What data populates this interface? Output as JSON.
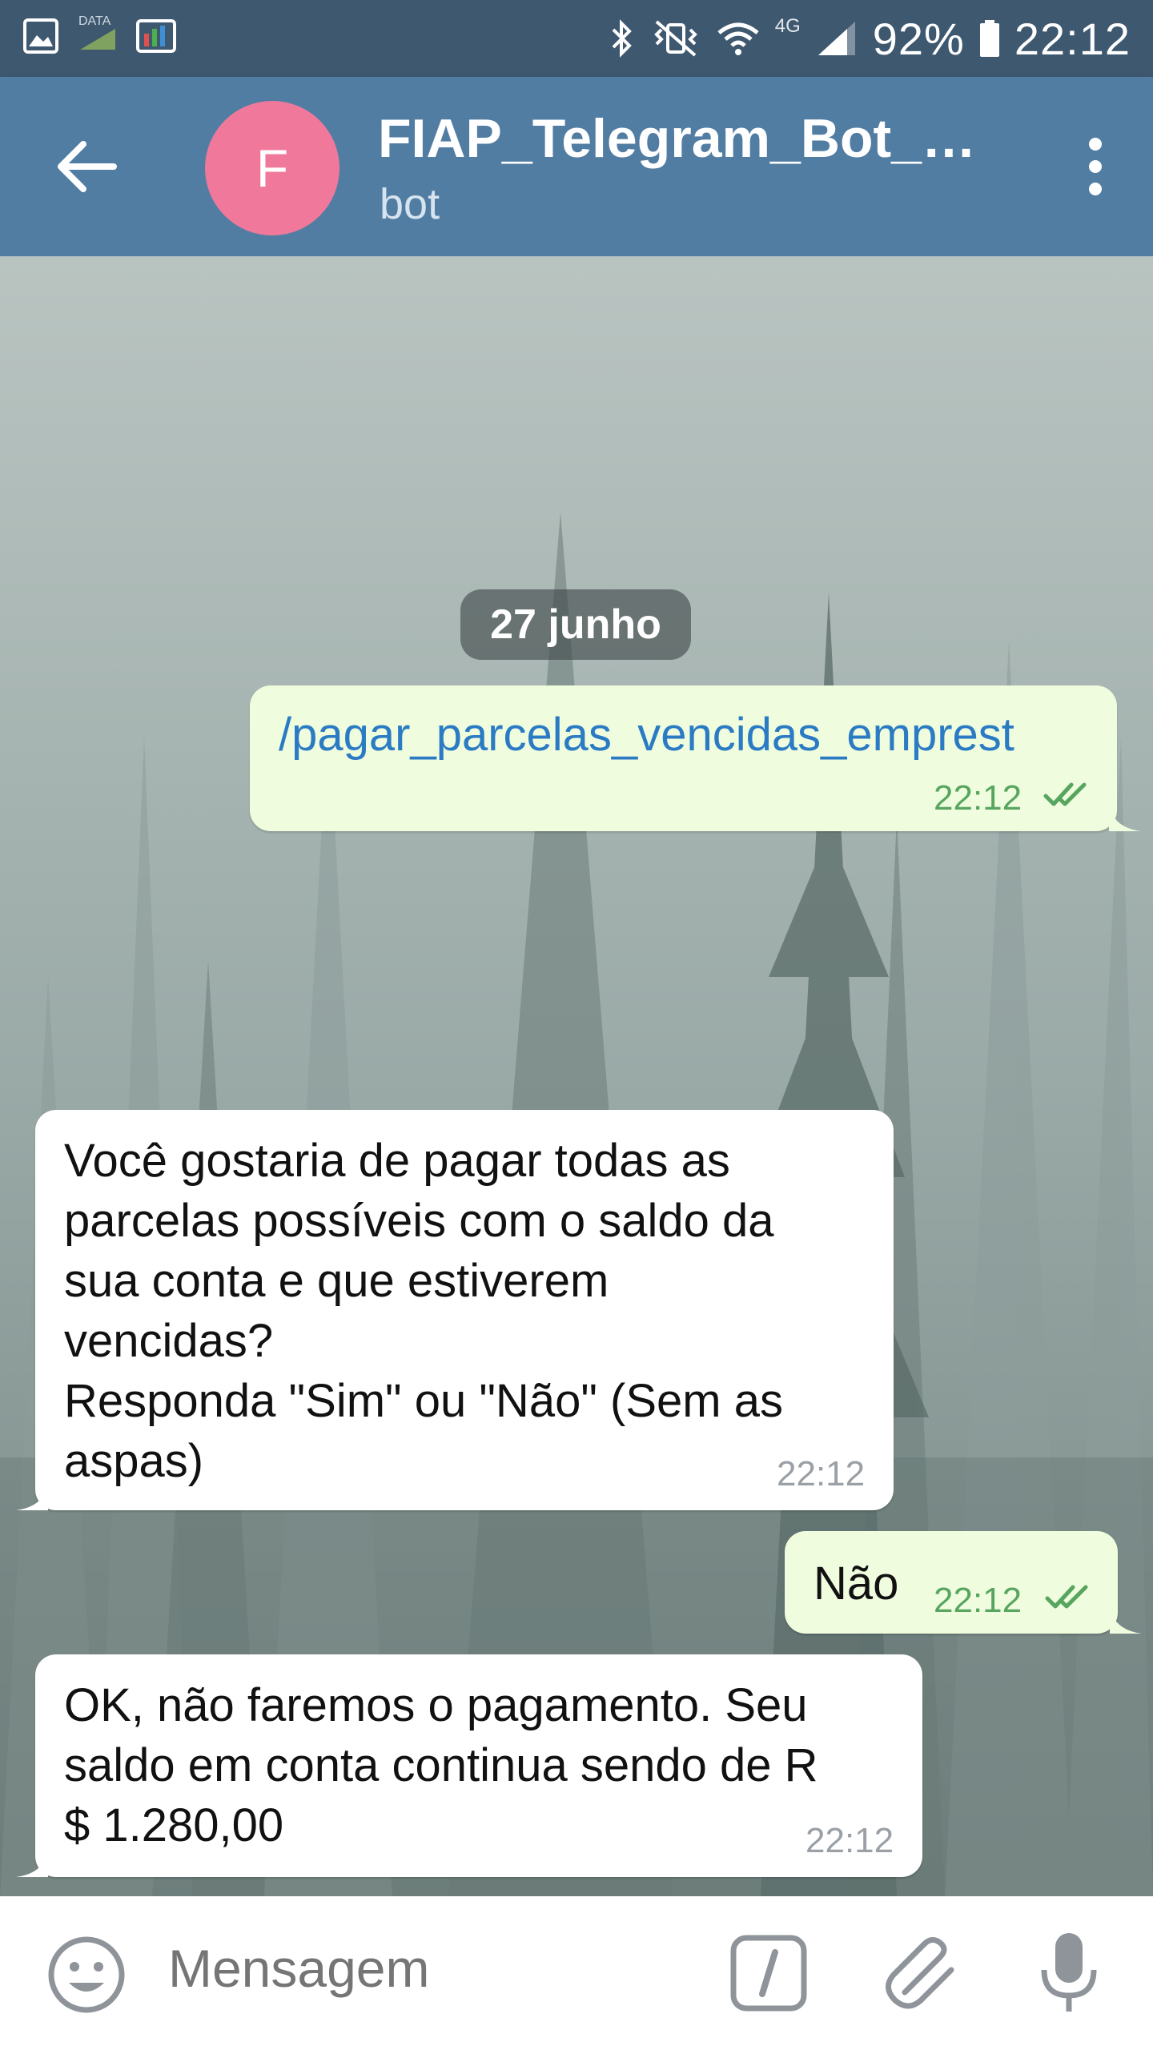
{
  "status_bar": {
    "battery": "92%",
    "time": "22:12",
    "network": "4G",
    "data_label": "DATA"
  },
  "header": {
    "avatar_letter": "F",
    "title": "FIAP_Telegram_Bot_D...",
    "subtitle": "bot"
  },
  "chat": {
    "date": "27 junho",
    "messages": [
      {
        "dir": "out",
        "text": "/pagar_parcelas_vencidas_emprest",
        "time": "22:12"
      },
      {
        "dir": "in",
        "lines": [
          "Você gostaria de pagar todas as",
          "parcelas possíveis com o saldo da",
          "sua conta e que estiverem",
          "vencidas?",
          "Responda \"Sim\" ou \"Não\" (Sem as",
          "aspas)"
        ],
        "time": "22:12"
      },
      {
        "dir": "out",
        "text": "Não",
        "time": "22:12"
      },
      {
        "dir": "in",
        "lines": [
          "OK, não faremos o pagamento. Seu",
          "saldo em conta continua sendo de R",
          "$ 1.280,00"
        ],
        "time": "22:12"
      }
    ]
  },
  "input": {
    "placeholder": "Mensagem"
  },
  "colors": {
    "status_bar": "#3e5870",
    "header": "#527da3",
    "avatar": "#f0799b",
    "outgoing_bubble": "#effdde",
    "incoming_bubble": "#ffffff",
    "command_link": "#2b7bc4",
    "read_check": "#58a55f"
  }
}
